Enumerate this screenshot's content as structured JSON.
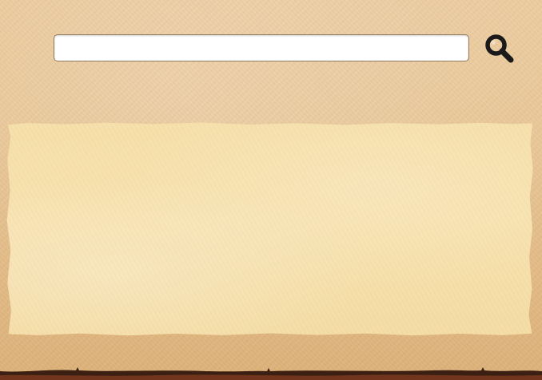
{
  "search": {
    "value": "",
    "placeholder": "",
    "button_icon": "magnifier-icon"
  },
  "colors": {
    "background": "#e9c695",
    "panel": "#f6dfa9",
    "icon": "#1a1a1a",
    "border_bottom": "#3a1f12"
  }
}
